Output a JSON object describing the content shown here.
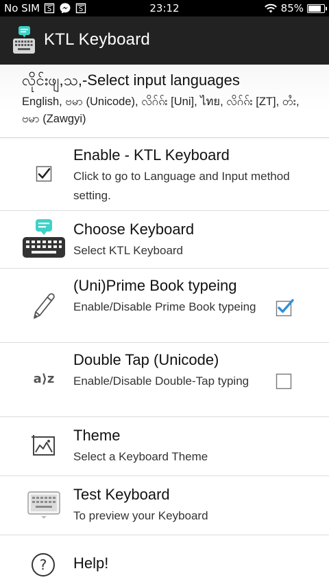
{
  "status_bar": {
    "carrier": "No SIM",
    "time": "23:12",
    "battery_percent": "85%",
    "battery_level": 0.85
  },
  "action_bar": {
    "title": "KTL Keyboard",
    "app_icon": "keyboard-chat-icon"
  },
  "header": {
    "title": "လိုင်းဖျ,သ,-Select input languages",
    "languages": "English, ဗမာ (Unicode), လိဂ်ၵ်း [Uni], ไทย, လိဂ်ၵ်း [ZT], တႆး, ဗမာ (Zawgyi)"
  },
  "settings": [
    {
      "id": "enable",
      "title": "Enable - KTL Keyboard",
      "summary": "Click to go to Language and Input method setting.",
      "icon": "checkbox-checked-icon",
      "checked": true
    },
    {
      "id": "choose",
      "title": "Choose Keyboard",
      "summary": "Select KTL Keyboard",
      "icon": "keyboard-chat-icon"
    },
    {
      "id": "prime",
      "title": "(Uni)Prime Book typeing",
      "summary": "Enable/Disable Prime Book typeing",
      "icon": "pencil-icon",
      "checked": true
    },
    {
      "id": "doubletap",
      "title": "Double Tap (Unicode)",
      "summary": "Enable/Disable Double-Tap typing",
      "icon": "a-to-z-icon",
      "icon_text": "a⟩z",
      "checked": false
    },
    {
      "id": "theme",
      "title": "Theme",
      "summary": "Select a Keyboard Theme",
      "icon": "picture-icon"
    },
    {
      "id": "test",
      "title": "Test Keyboard",
      "summary": "To preview your Keyboard",
      "icon": "keyboard-icon"
    },
    {
      "id": "help",
      "title": "Help!",
      "icon": "help-icon",
      "icon_text": "?"
    }
  ],
  "colors": {
    "action_bar": "#222222",
    "check_blue": "#2f8fd8",
    "divider": "#dcdcdc"
  }
}
